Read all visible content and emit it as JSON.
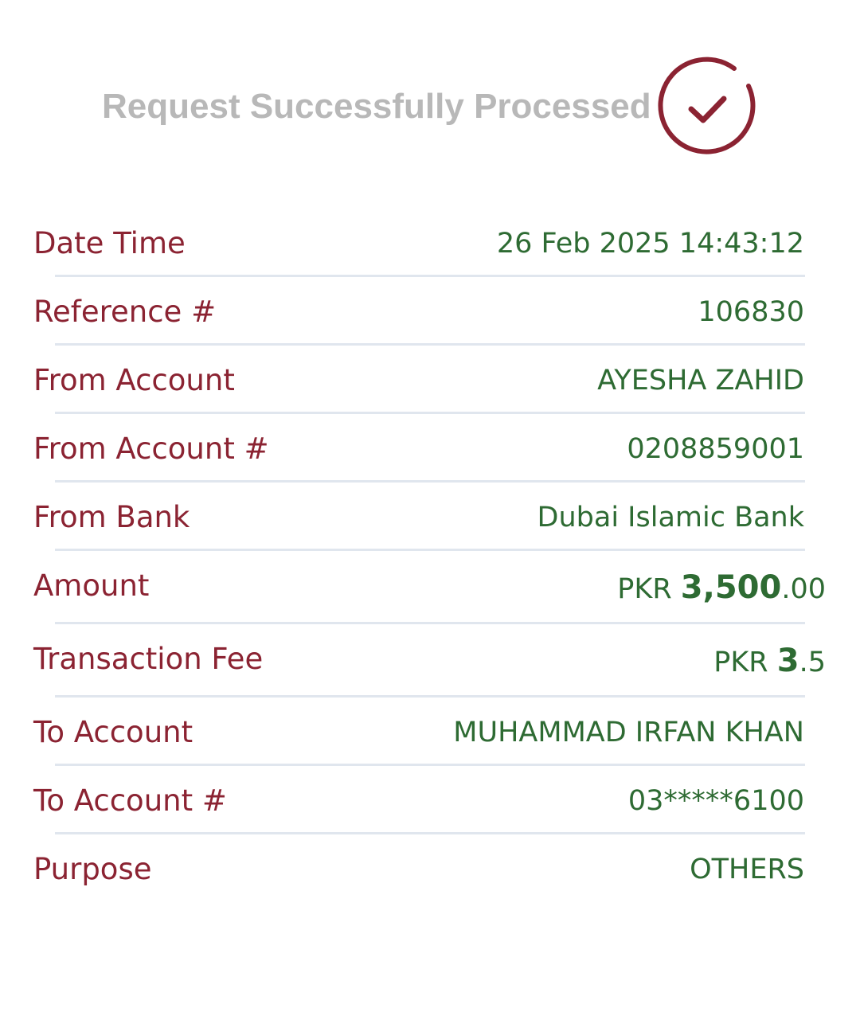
{
  "header": {
    "title": "Request Successfully Processed",
    "icon": "check-circle-icon",
    "accent_color": "#8b2332"
  },
  "colors": {
    "label": "#8b2332",
    "value": "#2e6b33",
    "title": "#b8b8b8",
    "divider": "#e0e6ee"
  },
  "details": {
    "date_time": {
      "label": "Date Time",
      "value": "26 Feb 2025 14:43:12"
    },
    "reference": {
      "label": "Reference #",
      "value": "106830"
    },
    "from_account": {
      "label": "From Account",
      "value": "AYESHA ZAHID"
    },
    "from_account_number": {
      "label": "From Account #",
      "value": "0208859001"
    },
    "from_bank": {
      "label": "From Bank",
      "value": "Dubai Islamic Bank"
    },
    "amount": {
      "label": "Amount",
      "currency": "PKR",
      "whole": "3,500",
      "decimal": ".00"
    },
    "transaction_fee": {
      "label": "Transaction Fee",
      "currency": "PKR",
      "whole": "3",
      "decimal": ".5"
    },
    "to_account": {
      "label": "To Account",
      "value": "MUHAMMAD IRFAN KHAN"
    },
    "to_account_number": {
      "label": "To Account #",
      "value": "03*****6100"
    },
    "purpose": {
      "label": "Purpose",
      "value": "OTHERS"
    }
  }
}
